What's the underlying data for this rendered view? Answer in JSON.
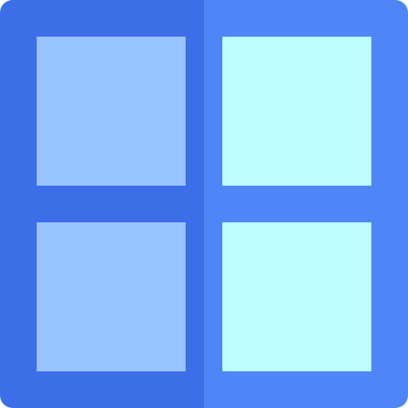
{
  "icon": {
    "name": "grid-icon",
    "colors": {
      "frame_left": "#3c6ee8",
      "frame_right": "#4f86f7",
      "tile_left": "#98c4ff",
      "tile_right": "#bdfcff"
    }
  }
}
